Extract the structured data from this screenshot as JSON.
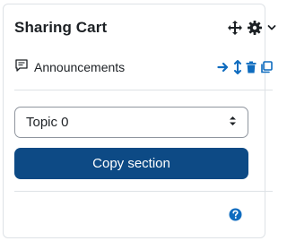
{
  "block": {
    "title": "Sharing Cart",
    "header_icons": [
      "move-icon",
      "gear-icon",
      "chevron-down-icon"
    ]
  },
  "item": {
    "label": "Announcements",
    "icon": "forum-icon",
    "actions": [
      "arrow-right-icon",
      "move-vertical-icon",
      "trash-icon",
      "copy-icon"
    ]
  },
  "section_select": {
    "selected": "Topic 0"
  },
  "copy_button": {
    "label": "Copy section"
  },
  "colors": {
    "accent": "#0f6cbf",
    "button_bg": "#0d4a85",
    "text": "#1d2125",
    "border": "#dee2e6"
  }
}
